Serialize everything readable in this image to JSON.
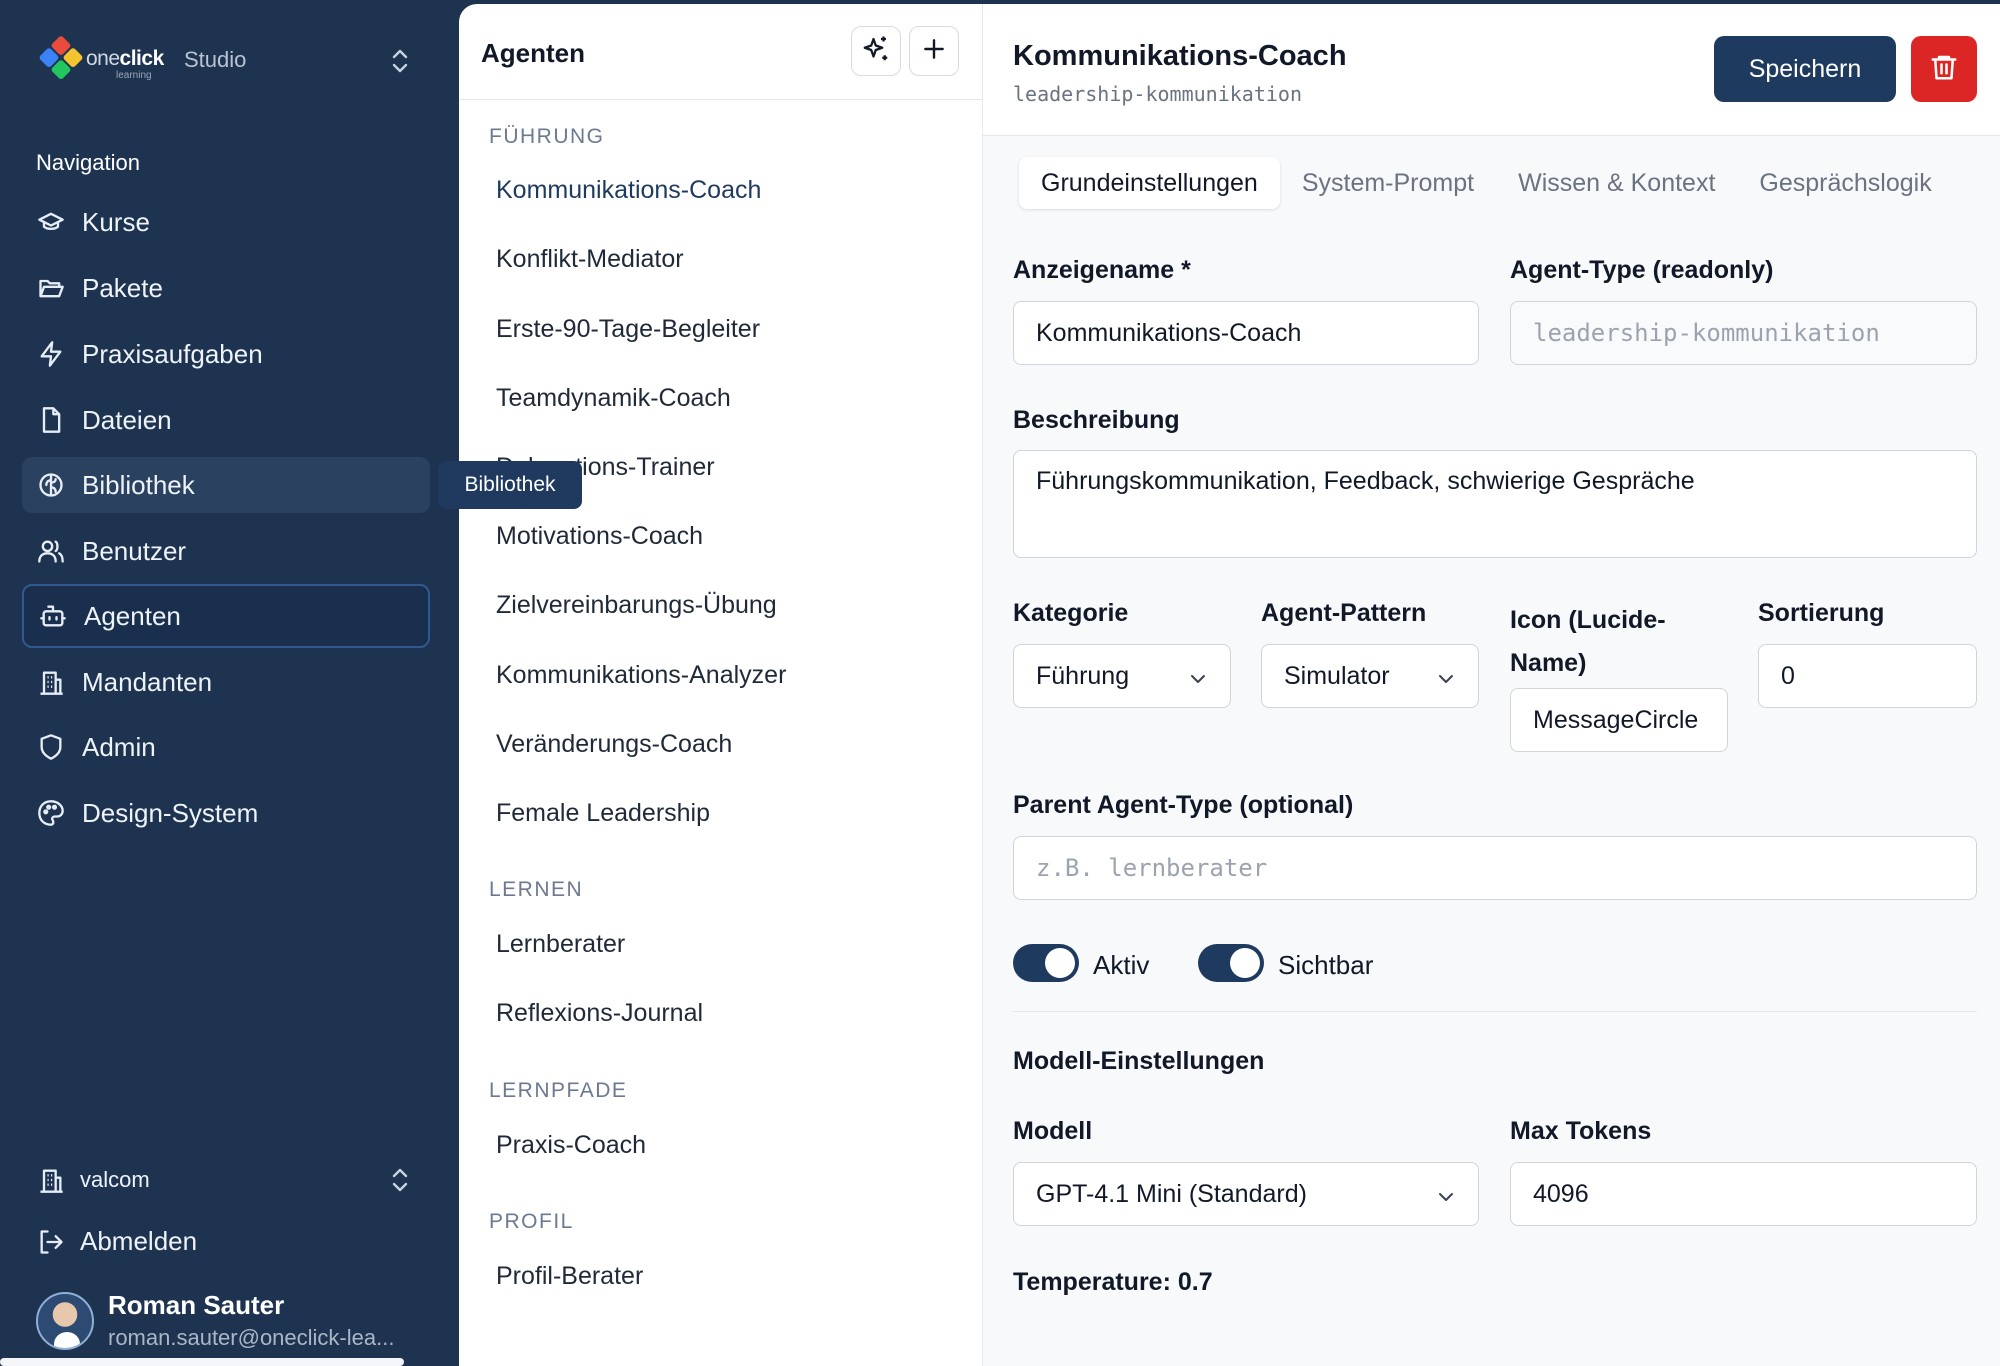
{
  "brand": {
    "logo_prefix": "one",
    "logo_bold": "click",
    "logo_sub": "learning",
    "product": "Studio"
  },
  "nav": {
    "title": "Navigation",
    "items": [
      {
        "label": "Kurse",
        "icon": "graduation-cap-icon"
      },
      {
        "label": "Pakete",
        "icon": "folder-open-icon"
      },
      {
        "label": "Praxisaufgaben",
        "icon": "zap-icon"
      },
      {
        "label": "Dateien",
        "icon": "file-icon"
      },
      {
        "label": "Bibliothek",
        "icon": "brain-icon"
      },
      {
        "label": "Benutzer",
        "icon": "users-icon"
      },
      {
        "label": "Agenten",
        "icon": "bot-icon"
      },
      {
        "label": "Mandanten",
        "icon": "building-icon"
      },
      {
        "label": "Admin",
        "icon": "shield-icon"
      },
      {
        "label": "Design-System",
        "icon": "palette-icon"
      }
    ],
    "tooltip": "Bibliothek",
    "tenant": "valcom",
    "logout": "Abmelden"
  },
  "user": {
    "name": "Roman Sauter",
    "email": "roman.sauter@oneclick-lea..."
  },
  "agent_list": {
    "title": "Agenten",
    "groups": [
      {
        "label": "FÜHRUNG",
        "items": [
          "Kommunikations-Coach",
          "Konflikt-Mediator",
          "Erste-90-Tage-Begleiter",
          "Teamdynamik-Coach",
          "Delegations-Trainer",
          "Motivations-Coach",
          "Zielvereinbarungs-Übung",
          "Kommunikations-Analyzer",
          "Veränderungs-Coach",
          "Female Leadership"
        ]
      },
      {
        "label": "LERNEN",
        "items": [
          "Lernberater",
          "Reflexions-Journal"
        ]
      },
      {
        "label": "LERNPFADE",
        "items": [
          "Praxis-Coach"
        ]
      },
      {
        "label": "PROFIL",
        "items": [
          "Profil-Berater"
        ]
      }
    ]
  },
  "editor": {
    "title": "Kommunikations-Coach",
    "slug": "leadership-kommunikation",
    "save": "Speichern",
    "tabs": [
      "Grundeinstellungen",
      "System-Prompt",
      "Wissen & Kontext",
      "Gesprächslogik"
    ],
    "display_name_label": "Anzeigename *",
    "display_name": "Kommunikations-Coach",
    "agent_type_label": "Agent-Type (readonly)",
    "agent_type": "leadership-kommunikation",
    "description_label": "Beschreibung",
    "description": "Führungskommunikation, Feedback, schwierige Gespräche",
    "category_label": "Kategorie",
    "category": "Führung",
    "pattern_label": "Agent-Pattern",
    "pattern": "Simulator",
    "icon_label": "Icon (Lucide-Name)",
    "icon_value": "MessageCircle",
    "sort_label": "Sortierung",
    "sort_value": "0",
    "parent_label": "Parent Agent-Type (optional)",
    "parent_placeholder": "z.B. lernberater",
    "toggle_active": "Aktiv",
    "toggle_visible": "Sichtbar",
    "model_section": "Modell-Einstellungen",
    "model_label": "Modell",
    "model": "GPT-4.1 Mini (Standard)",
    "max_tokens_label": "Max Tokens",
    "max_tokens": "4096",
    "temperature_label": "Temperature: 0.7"
  },
  "colors": {
    "sidebar": "#1e3350",
    "accent": "#1e3a5f",
    "danger": "#dc2626"
  }
}
